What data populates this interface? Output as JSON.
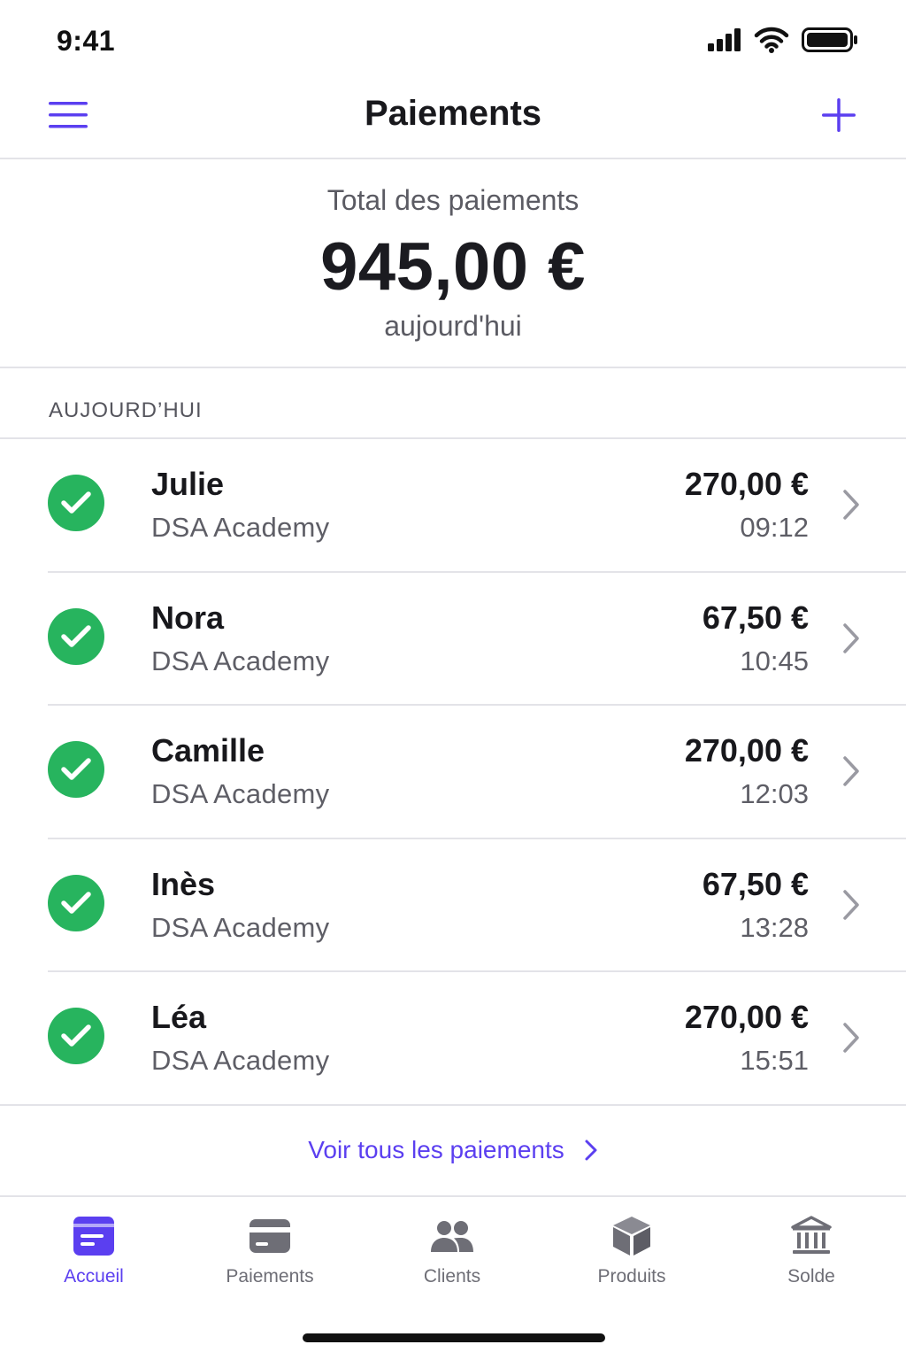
{
  "status_bar": {
    "time": "9:41"
  },
  "nav": {
    "title": "Paiements",
    "menu_icon": "hamburger-menu-icon",
    "add_icon": "plus-icon"
  },
  "summary": {
    "label": "Total des paiements",
    "amount": "945,00 €",
    "period": "aujourd'hui"
  },
  "section": {
    "title": "AUJOURD’HUI"
  },
  "payments": [
    {
      "name": "Julie",
      "merchant": "DSA Academy",
      "amount": "270,00 €",
      "time": "09:12"
    },
    {
      "name": "Nora",
      "merchant": "DSA Academy",
      "amount": "67,50 €",
      "time": "10:45"
    },
    {
      "name": "Camille",
      "merchant": "DSA Academy",
      "amount": "270,00 €",
      "time": "12:03"
    },
    {
      "name": "Inès",
      "merchant": "DSA Academy",
      "amount": "67,50 €",
      "time": "13:28"
    },
    {
      "name": "Léa",
      "merchant": "DSA Academy",
      "amount": "270,00 €",
      "time": "15:51"
    }
  ],
  "see_all": {
    "label": "Voir tous les paiements"
  },
  "tabs": [
    {
      "label": "Accueil",
      "icon": "home-icon",
      "active": true
    },
    {
      "label": "Paiements",
      "icon": "card-icon",
      "active": false
    },
    {
      "label": "Clients",
      "icon": "users-icon",
      "active": false
    },
    {
      "label": "Produits",
      "icon": "box-icon",
      "active": false
    },
    {
      "label": "Solde",
      "icon": "bank-icon",
      "active": false
    }
  ],
  "colors": {
    "accent": "#5b3ff0",
    "success": "#27b45e",
    "text": "#18181c",
    "muted": "#5e5e66",
    "divider": "#e3e3e8"
  }
}
